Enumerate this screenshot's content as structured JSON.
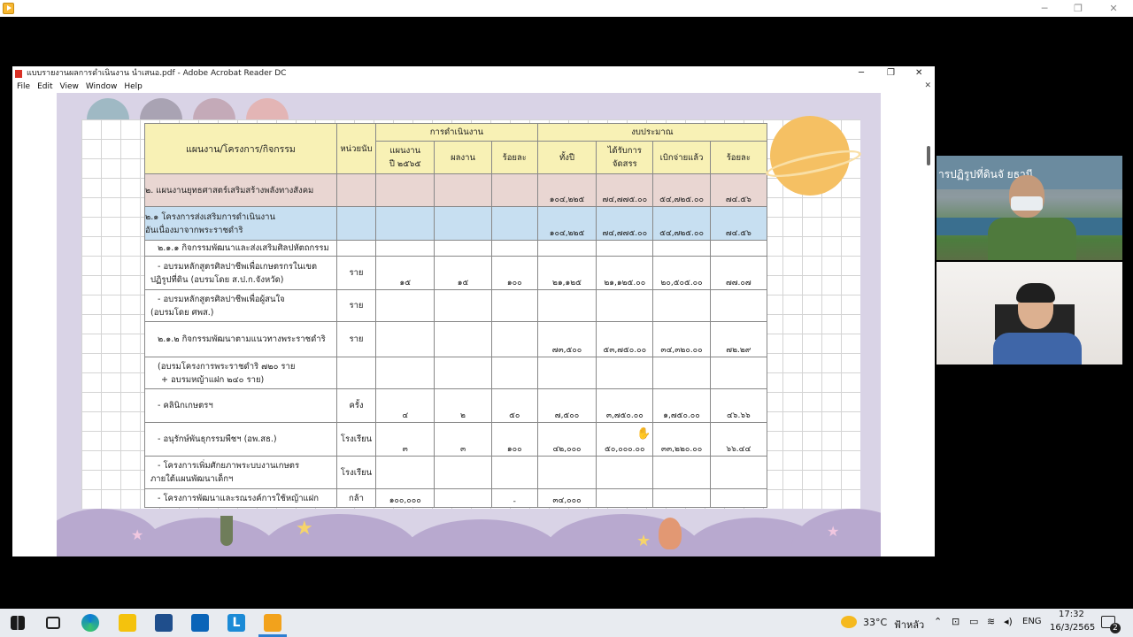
{
  "acrobat": {
    "title": "แบบรายงานผลการดำเนินงาน นำเสนอ.pdf - Adobe Acrobat Reader DC",
    "menu": [
      "File",
      "Edit",
      "View",
      "Window",
      "Help"
    ]
  },
  "table": {
    "headers": {
      "plan": "แผนงาน/โครงการ/กิจกรรม",
      "unit": "หน่วยนับ",
      "operation": "การดำเนินงาน",
      "budget": "งบประมาณ",
      "target_line1": "แผนงาน",
      "target_line2": "ปี ๒๕๖๕",
      "result": "ผลงาน",
      "percent": "ร้อยละ",
      "whole_year": "ทั้งปี",
      "allocated_line1": "ได้รับการ",
      "allocated_line2": "จัดสรร",
      "disbursed": "เบิกจ่ายแล้ว",
      "percent2": "ร้อยละ"
    },
    "rows": [
      {
        "name": "๒. แผนงานยุทธศาสตร์เสริมสร้างพลังทางสังคม",
        "unit": "",
        "target": "",
        "result": "",
        "pct": "",
        "year": "๑๐๔,๒๒๕",
        "alloc": "๗๔,๗๗๕.๐๐",
        "spent": "๕๔,๗๒๕.๐๐",
        "pct2": "๗๔.๕๖"
      },
      {
        "name": "๒.๑ โครงการส่งเสริมการดำเนินงาน",
        "name2": "อันเนื่องมาจากพระราชดำริ",
        "unit": "",
        "target": "",
        "result": "",
        "pct": "",
        "year": "๑๐๔,๒๒๕",
        "alloc": "๗๔,๗๗๕.๐๐",
        "spent": "๕๔,๗๒๕.๐๐",
        "pct2": "๗๔.๕๖"
      },
      {
        "name": "๒.๑.๑ กิจกรรมพัฒนาและส่งเสริมศิลปหัตถกรรม",
        "unit": "",
        "target": "",
        "result": "",
        "pct": "",
        "year": "",
        "alloc": "",
        "spent": "",
        "pct2": ""
      },
      {
        "name": "- อบรมหลักสูตรศิลปาชีพเพื่อเกษตรกรในเขต",
        "name2": "ปฏิรูปที่ดิน (อบรมโดย ส.ป.ก.จังหวัด)",
        "unit": "ราย",
        "target": "๑๕",
        "result": "๑๕",
        "pct": "๑๐๐",
        "year": "๒๑,๑๒๕",
        "alloc": "๒๑,๑๒๕.๐๐",
        "spent": "๒๐,๕๐๕.๐๐",
        "pct2": "๗๗.๐๗"
      },
      {
        "name": "- อบรมหลักสูตรศิลปาชีพเพื่อผู้สนใจ",
        "name2": "(อบรมโดย ศพส.)",
        "unit": "ราย",
        "target": "",
        "result": "",
        "pct": "",
        "year": "",
        "alloc": "",
        "spent": "",
        "pct2": ""
      },
      {
        "name": "๒.๑.๒ กิจกรรมพัฒนาตามแนวทางพระราชดำริ",
        "unit": "ราย",
        "target": "",
        "result": "",
        "pct": "",
        "year": "๗๓,๕๐๐",
        "alloc": "๕๓,๗๕๐.๐๐",
        "spent": "๓๔,๓๒๐.๐๐",
        "pct2": "๗๒.๒๙"
      },
      {
        "name": "(อบรมโครงการพระราชดำริ ๗๒๐ ราย",
        "name2": "+ อบรมหญ้าแฝก ๒๔๐ ราย)",
        "unit": "",
        "target": "",
        "result": "",
        "pct": "",
        "year": "",
        "alloc": "",
        "spent": "",
        "pct2": ""
      },
      {
        "name": "- คลินิกเกษตรฯ",
        "unit": "ครั้ง",
        "target": "๔",
        "result": "๒",
        "pct": "๕๐",
        "year": "๗,๕๐๐",
        "alloc": "๓,๗๕๐.๐๐",
        "spent": "๑,๗๕๐.๐๐",
        "pct2": "๔๖.๖๖"
      },
      {
        "name": "- อนุรักษ์พันธุกรรมพืชฯ (อพ.สธ.)",
        "unit": "โรงเรียน",
        "target": "๓",
        "result": "๓",
        "pct": "๑๐๐",
        "year": "๔๒,๐๐๐",
        "alloc": "๕๐,๐๐๐.๐๐",
        "spent": "๓๓,๒๒๐.๐๐",
        "pct2": "๖๖.๔๔"
      },
      {
        "name": "- โครงการเพิ่มศักยภาพระบบงานเกษตร",
        "name2": "ภายใต้แผนพัฒนาเด็กฯ",
        "unit": "โรงเรียน",
        "target": "",
        "result": "",
        "pct": "",
        "year": "",
        "alloc": "",
        "spent": "",
        "pct2": ""
      },
      {
        "name": "- โครงการพัฒนาและรณรงค์การใช้หญ้าแฝก",
        "unit": "กล้า",
        "target": "๑๐๐,๐๐๐",
        "result": "",
        "pct": "-",
        "year": "๓๔,๐๐๐",
        "alloc": "",
        "spent": "",
        "pct2": ""
      }
    ]
  },
  "webcam": {
    "banner_text": "ารปฏิรูปที่ดินจั  ยธานี"
  },
  "taskbar": {
    "weather_temp": "33°C",
    "weather_text": "ฟ้าหลัว",
    "lang": "ENG",
    "time": "17:32",
    "date": "16/3/2565",
    "notif_count": "2"
  }
}
